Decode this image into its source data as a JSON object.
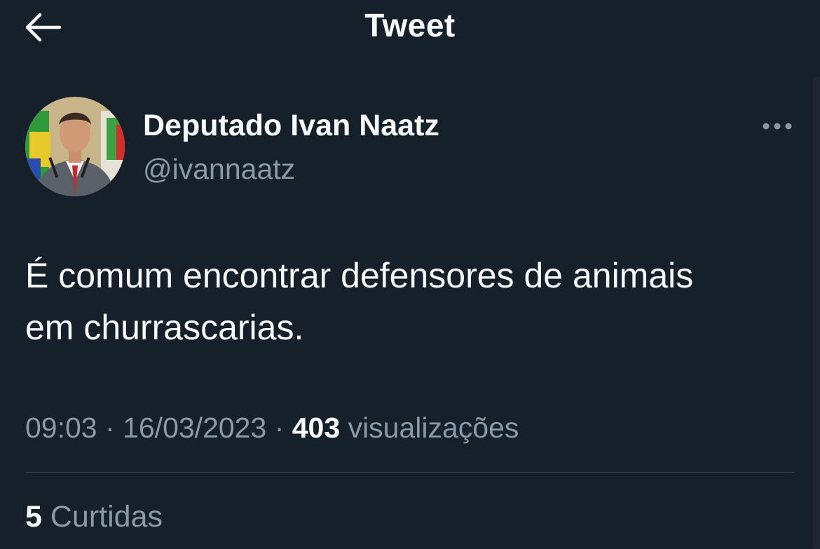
{
  "header": {
    "title": "Tweet",
    "back_icon": "arrow-left-icon"
  },
  "author": {
    "display_name": "Deputado Ivan Naatz",
    "handle": "@ivannaatz",
    "avatar_icon": "profile-photo",
    "more_icon": "ellipsis-icon"
  },
  "tweet": {
    "text_line1": "É comum encontrar defensores de animais",
    "text_line2": "em churrascarias.",
    "time": "09:03",
    "separator": "·",
    "date": "16/03/2023",
    "views_count": "403",
    "views_label": "visualizações",
    "likes_count": "5",
    "likes_label": "Curtidas"
  },
  "colors": {
    "background": "#15202b",
    "primary_text": "#f7f9f9",
    "secondary_text": "#8b98a5",
    "divider": "#38444d"
  }
}
